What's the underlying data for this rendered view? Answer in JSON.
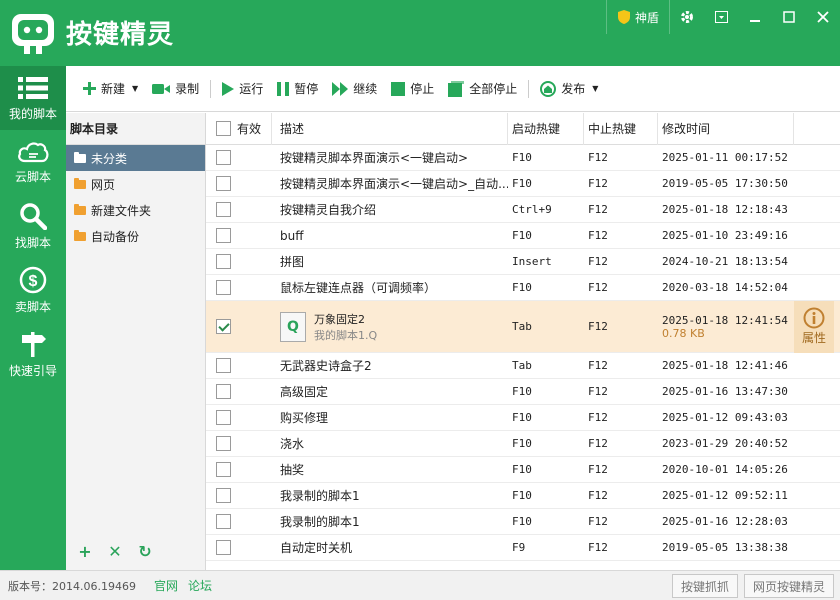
{
  "app": {
    "title": "按键精灵",
    "shield_label": "神盾"
  },
  "nav": [
    {
      "label": "我的脚本",
      "icon": "list-icon"
    },
    {
      "label": "云脚本",
      "icon": "cloud-icon"
    },
    {
      "label": "找脚本",
      "icon": "search-icon"
    },
    {
      "label": "卖脚本",
      "icon": "dollar-icon"
    },
    {
      "label": "快速引导",
      "icon": "signpost-icon"
    }
  ],
  "toolbar": {
    "new": "新建",
    "record": "录制",
    "run": "运行",
    "pause": "暂停",
    "resume": "继续",
    "stop": "停止",
    "stop_all": "全部停止",
    "publish": "发布"
  },
  "dir": {
    "header": "脚本目录",
    "items": [
      "未分类",
      "网页",
      "新建文件夹",
      "自动备份"
    ]
  },
  "table": {
    "headers": {
      "enabled": "有效",
      "desc": "描述",
      "start": "启动热键",
      "stop": "中止热键",
      "time": "修改时间"
    },
    "rows": [
      {
        "desc": "按键精灵脚本界面演示<一键启动>",
        "start": "F10",
        "stop": "F12",
        "time": "2025-01-11 00:17:52",
        "checked": false
      },
      {
        "desc": "按键精灵脚本界面演示<一键启动>_自动...",
        "start": "F10",
        "stop": "F12",
        "time": "2019-05-05 17:30:50",
        "checked": false
      },
      {
        "desc": "按键精灵自我介绍",
        "start": "Ctrl+9",
        "stop": "F12",
        "time": "2025-01-18 12:18:43",
        "checked": false
      },
      {
        "desc": "buff",
        "start": "F10",
        "stop": "F12",
        "time": "2025-01-10 23:49:16",
        "checked": false
      },
      {
        "desc": "拼图",
        "start": "Insert",
        "stop": "F12",
        "time": "2024-10-21 18:13:54",
        "checked": false
      },
      {
        "desc": "鼠标左键连点器（可调频率）",
        "start": "F10",
        "stop": "F12",
        "time": "2020-03-18 14:52:04",
        "checked": false
      }
    ],
    "selected": {
      "desc": "万象固定2",
      "file": "我的脚本1.Q",
      "start": "Tab",
      "stop": "F12",
      "time": "2025-01-18 12:41:54",
      "size": "0.78 KB",
      "prop_label": "属性",
      "checked": true
    },
    "rows2": [
      {
        "desc": "无武器史诗盒子2",
        "start": "Tab",
        "stop": "F12",
        "time": "2025-01-18 12:41:46",
        "checked": false
      },
      {
        "desc": "高级固定",
        "start": "F10",
        "stop": "F12",
        "time": "2025-01-16 13:47:30",
        "checked": false
      },
      {
        "desc": "购买修理",
        "start": "F10",
        "stop": "F12",
        "time": "2025-01-12 09:43:03",
        "checked": false
      },
      {
        "desc": "浇水",
        "start": "F10",
        "stop": "F12",
        "time": "2023-01-29 20:40:52",
        "checked": false
      },
      {
        "desc": "抽奖",
        "start": "F10",
        "stop": "F12",
        "time": "2020-10-01 14:05:26",
        "checked": false
      },
      {
        "desc": "我录制的脚本1",
        "start": "F10",
        "stop": "F12",
        "time": "2025-01-12 09:52:11",
        "checked": false
      },
      {
        "desc": "我录制的脚本1",
        "start": "F10",
        "stop": "F12",
        "time": "2025-01-16 12:28:03",
        "checked": false
      },
      {
        "desc": "自动定时关机",
        "start": "F9",
        "stop": "F12",
        "time": "2019-05-05 13:38:38",
        "checked": false
      }
    ]
  },
  "status": {
    "version": "版本号：2014.06.19469",
    "link1": "官网",
    "link2": "论坛",
    "btn1": "按键抓抓",
    "btn2": "网页按键精灵"
  },
  "colors": {
    "brand": "#27a85a",
    "selected_row": "#fcebd4",
    "selected_dir": "#5a7a93"
  }
}
